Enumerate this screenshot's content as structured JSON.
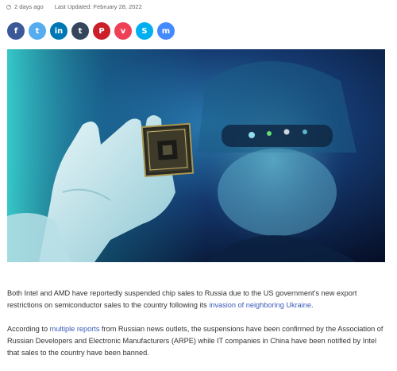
{
  "meta": {
    "published": "2 days ago",
    "updated": "Last Updated: February 28, 2022"
  },
  "share": {
    "buttons": [
      {
        "network": "facebook",
        "icon": "facebook-icon",
        "color": "#3b5998",
        "glyph": "f"
      },
      {
        "network": "twitter",
        "icon": "twitter-icon",
        "color": "#55acee",
        "glyph": "t"
      },
      {
        "network": "linkedin",
        "icon": "linkedin-icon",
        "color": "#0077b5",
        "glyph": "in"
      },
      {
        "network": "tumblr",
        "icon": "tumblr-icon",
        "color": "#35465c",
        "glyph": "t"
      },
      {
        "network": "pinterest",
        "icon": "pinterest-icon",
        "color": "#cb2027",
        "glyph": "P"
      },
      {
        "network": "pocket",
        "icon": "pocket-icon",
        "color": "#ef4056",
        "glyph": "v"
      },
      {
        "network": "skype",
        "icon": "skype-icon",
        "color": "#00aff0",
        "glyph": "S"
      },
      {
        "network": "messenger",
        "icon": "messenger-icon",
        "color": "#448aff",
        "glyph": "m"
      }
    ]
  },
  "hero": {
    "colors": {
      "background": "#0a1a3a",
      "accent": "#29d4d8",
      "glove": "#d8eef2"
    }
  },
  "article": {
    "p1_before": "Both Intel and AMD have reportedly suspended chip sales to Russia due to the US government's new export restrictions on semiconductor sales to the country following its ",
    "p1_link": "invasion of neighboring Ukraine",
    "p1_after": ".",
    "p2_before": "According to ",
    "p2_link": "multiple reports",
    "p2_after": " from Russian news outlets, the suspensions have been confirmed by the Association of Russian Developers and Electronic Manufacturers (ARPE) while IT companies in China have been notified by Intel that sales to the country have been banned.",
    "link_color": "#3b5bb8"
  }
}
